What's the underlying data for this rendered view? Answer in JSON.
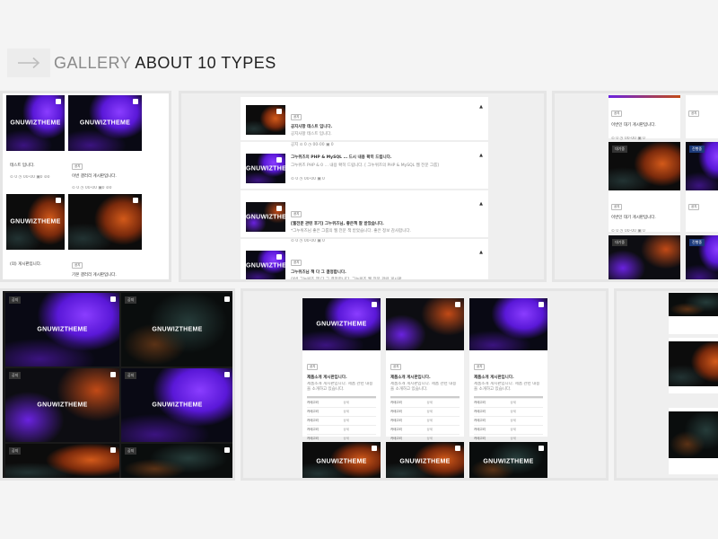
{
  "header": {
    "title_light": "GALLERY",
    "title_dark": "ABOUT 10 TYPES"
  },
  "watermark": "GNUWIZTHEME",
  "panel1": {
    "cards": [
      {
        "title": "테스트 입니다.",
        "meta": "⊙ 0 ◷ 00-00 ▣0 ⊘0"
      },
      {
        "title": "이번 갤러리 게시판입니다.",
        "meta": "⊙ 0 ◷ 00-00 ▣0 ⊘0",
        "badge": "공지"
      },
      {
        "title": "(의) 게시판입니다.",
        "meta": ""
      },
      {
        "title": "기본 갤러리 게시판입니다.",
        "meta": "⊙ 0 ◷ 00-00 ▣0 ⊘0",
        "badge": "공지"
      }
    ]
  },
  "panel2": {
    "rows": [
      {
        "badge": "공지",
        "title": "공지사항 테스트 입니다.",
        "desc": "공지사항 테스트 입니다.",
        "meta": "공지  ⊙ 0  ◷ 00-00  ▣ 0"
      },
      {
        "badge": "",
        "title": "그누위즈의 PHP & MySQL … 드시 내용 확히 드립니다.",
        "desc": "그누위즈 PHP & 0 … 내용 확히 드립니다.  [ 그누위즈의 PHP & MySQL 웹 전문 그룹]",
        "meta": "⊙ 0  ◷ 00-00  ▣ 0"
      },
      {
        "badge": "공지",
        "title": "[웹전문 관련 후기] 그누위즈님, 좋은책 잘 받았습니다.",
        "desc": "*그누위즈님 좋은 그룹의 웹 전문 책 받았습니다. 좋은 정보 감사합니다.",
        "meta": "⊙ 0  ◷ 00-00  ▣ 0"
      },
      {
        "badge": "공지",
        "title": "그누위즈님 책 다 그 결정합니다.",
        "desc": "이번 그누위즈 책 다 그 결정합니다.  그누위즈 웹 전문 관련 게시판 …",
        "meta": "⊙ 0  ◷ 00-00  ▣ 0"
      }
    ]
  },
  "panel3": {
    "cells": [
      {
        "title": "이번인 대기 게시판입니다.",
        "meta": "⊙ 0 ◷ 00-00 ▣ 0",
        "badge": "공지"
      },
      {
        "title": "이번인 대기 게시판입니다.",
        "meta": "⊙ 0 ◷ 00-00 ▣ 0",
        "badge": "공지"
      },
      {
        "title": "이번인 대기 게시판입니다.",
        "meta": "⊙ 0 ◷ 00-00 ▣ 0",
        "badge": "공지"
      }
    ],
    "tags": [
      "대기중",
      "진행중"
    ]
  },
  "panel4": {
    "tag": "공지"
  },
  "panel5": {
    "cards": [
      {
        "badge": "공지",
        "title": "제품소개 게시판입니다.",
        "desc": "제품소개 게시판입니다. 제품 관련 내용을 소개하고 있습니다.",
        "specs": [
          [
            "카테고리",
            "상세"
          ],
          [
            "카테고리",
            "상세"
          ],
          [
            "카테고리",
            "상세"
          ],
          [
            "카테고리",
            "상세"
          ],
          [
            "카테고리",
            "상세"
          ]
        ]
      },
      {
        "badge": "공지",
        "title": "제품소개 게시판입니다.",
        "desc": "제품소개 게시판입니다. 제품 관련 내용을 소개하고 있습니다.",
        "specs": [
          [
            "카테고리",
            "상세"
          ],
          [
            "카테고리",
            "상세"
          ],
          [
            "카테고리",
            "상세"
          ],
          [
            "카테고리",
            "상세"
          ],
          [
            "카테고리",
            "상세"
          ]
        ]
      },
      {
        "badge": "공지",
        "title": "제품소개 게시판입니다.",
        "desc": "제품소개 게시판입니다. 제품 관련 내용을 소개하고 있습니다.",
        "specs": [
          [
            "카테고리",
            "상세"
          ],
          [
            "카테고리",
            "상세"
          ],
          [
            "카테고리",
            "상세"
          ],
          [
            "카테고리",
            "상세"
          ],
          [
            "카테고리",
            "상세"
          ]
        ]
      }
    ]
  }
}
